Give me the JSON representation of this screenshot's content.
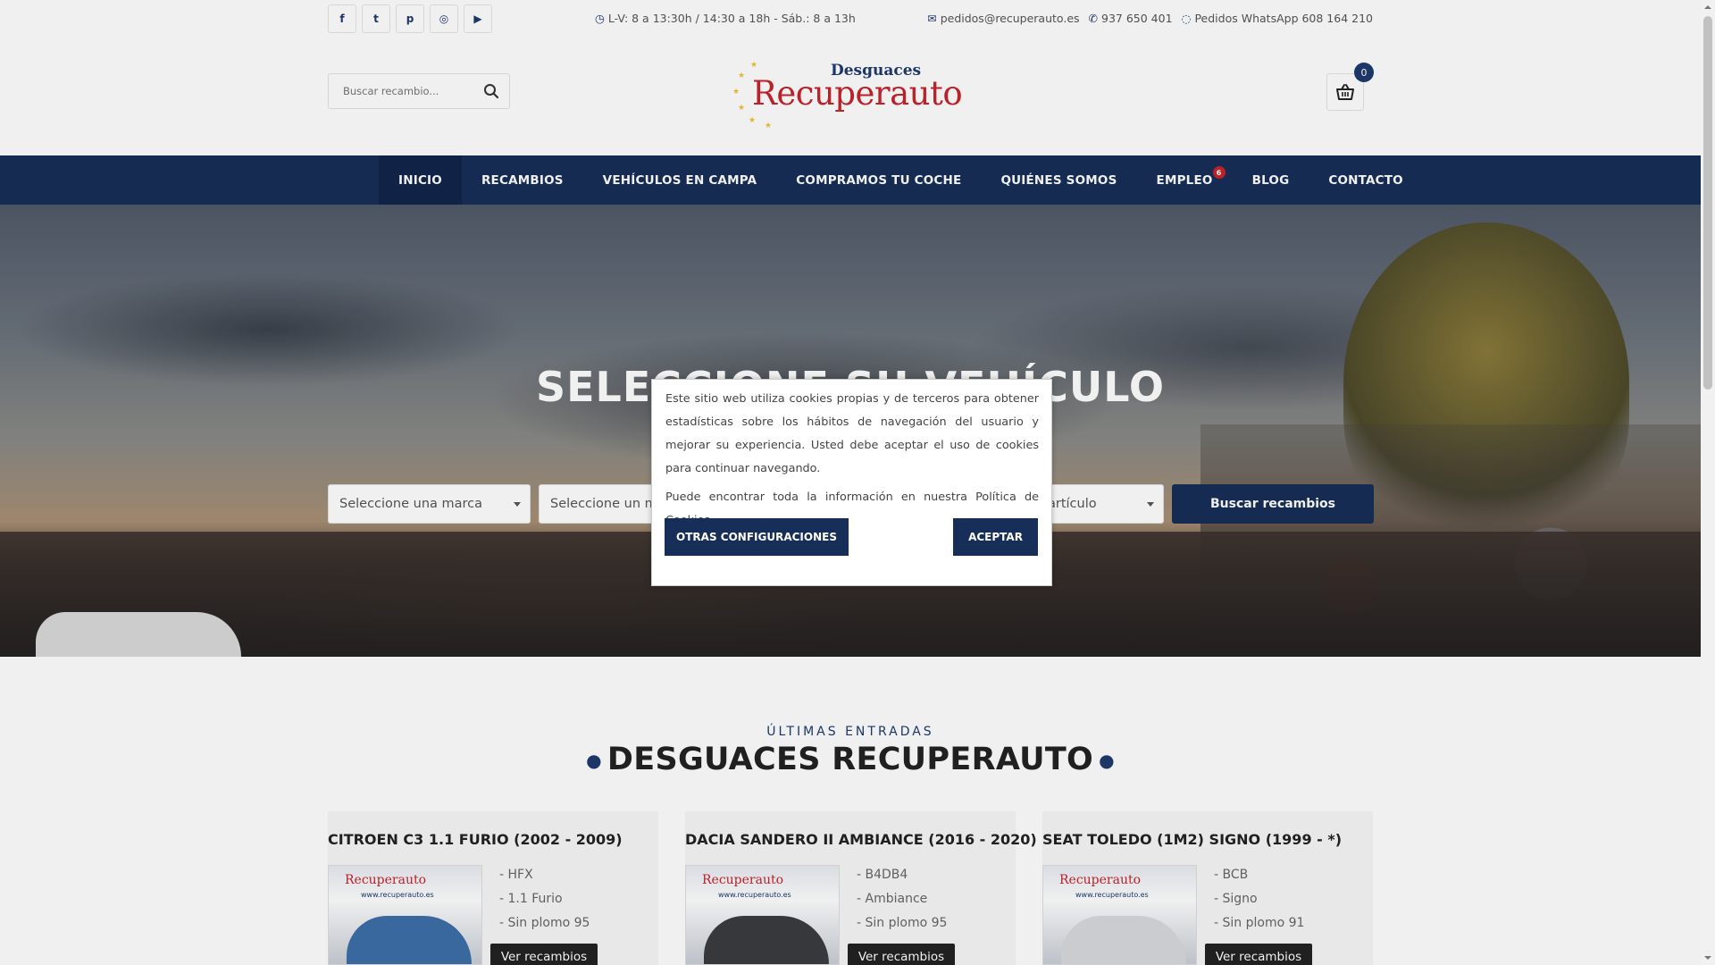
{
  "topbar": {
    "social": [
      {
        "name": "facebook-icon",
        "glyph": "f"
      },
      {
        "name": "twitter-icon",
        "glyph": "t"
      },
      {
        "name": "pinterest-icon",
        "glyph": "p"
      },
      {
        "name": "instagram-icon",
        "glyph": "◎"
      },
      {
        "name": "youtube-icon",
        "glyph": "▶"
      }
    ],
    "hours": "L-V: 8 a 13:30h / 14:30 a 18h - Sáb.: 8 a 13h",
    "email": "pedidos@recuperauto.es",
    "phone": "937 650 401",
    "whatsapp": "Pedidos WhatsApp 608 164 210"
  },
  "header": {
    "search_placeholder": "Buscar recambio...",
    "logo_top": "Desguaces",
    "logo_main": "Recuperauto",
    "cart_count": "0"
  },
  "nav": {
    "items": [
      {
        "label": "INICIO",
        "active": true
      },
      {
        "label": "RECAMBIOS"
      },
      {
        "label": "VEHÍCULOS EN CAMPA"
      },
      {
        "label": "COMPRAMOS TU COCHE"
      },
      {
        "label": "QUIÉNES SOMOS"
      },
      {
        "label": "EMPLEO",
        "badge": "6"
      },
      {
        "label": "BLOG"
      },
      {
        "label": "CONTACTO"
      }
    ]
  },
  "hero": {
    "title": "SELECCIONE SU VEHÍCULO",
    "select_brand": "Seleccione una marca",
    "select_model": "Seleccione un mo",
    "select_article": "artículo",
    "search_button": "Buscar recambios"
  },
  "latest": {
    "subheading": "ÚLTIMAS ENTRADAS",
    "heading": "DESGUACES RECUPERAUTO",
    "thumb_brand": "Recuperauto",
    "thumb_url": "www.recuperauto.es",
    "button_label": "Ver recambios",
    "cards": [
      {
        "title": "CITROEN C3 1.1 FURIO (2002 - 2009)",
        "specs": [
          "- HFX",
          "- 1.1 Furio",
          "- Sin plomo 95"
        ],
        "car_color": "#3d6fa8"
      },
      {
        "title": "DACIA SANDERO II AMBIANCE (2016 - 2020)",
        "specs": [
          "- B4DB4",
          "- Ambiance",
          "- Sin plomo 95"
        ],
        "car_color": "#3a3c40"
      },
      {
        "title": "SEAT TOLEDO (1M2) SIGNO (1999 - *)",
        "specs": [
          "- BCB",
          "- Signo",
          "- Sin plomo 91"
        ],
        "car_color": "#d8d9dc"
      }
    ]
  },
  "cookie": {
    "text1": "Este sitio web utiliza cookies propias y de terceros para obtener estadísticas sobre los hábitos de navegación del usuario y mejorar su experiencia. Usted debe aceptar el uso de cookies para continuar navegando.",
    "text2": "Puede encontrar toda la información en nuestra Política de Cookies.",
    "btn_config": "OTRAS CONFIGURACIONES",
    "btn_accept": "ACEPTAR"
  },
  "colors": {
    "primary": "#172e58",
    "brand_red": "#c7242b",
    "logo_star": "#f1c232"
  }
}
